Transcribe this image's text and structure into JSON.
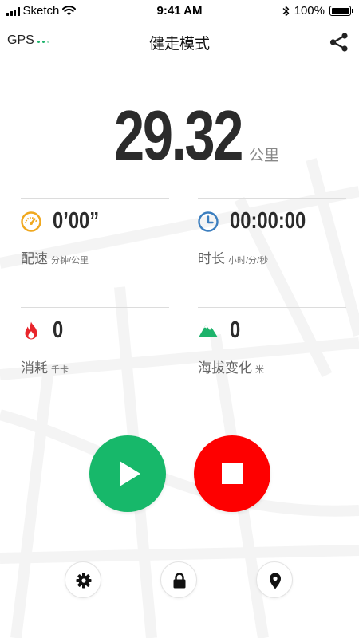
{
  "status_bar": {
    "carrier": "Sketch",
    "time": "9:41 AM",
    "battery": "100%",
    "icons": [
      "signal-icon",
      "wifi-icon",
      "bluetooth-icon",
      "battery-icon"
    ]
  },
  "nav": {
    "gps_label": "GPS",
    "title": "健走模式",
    "share_icon": "share-icon"
  },
  "distance": {
    "value": "29.32",
    "unit": "公里"
  },
  "stats": {
    "pace": {
      "value": "0’00”",
      "label": "配速",
      "unit": "分钟/公里",
      "icon": "speedometer-icon"
    },
    "duration": {
      "value": "00:00:00",
      "label": "时长",
      "unit": "小时/分/秒",
      "icon": "clock-icon"
    },
    "calories": {
      "value": "0",
      "label": "消耗",
      "unit": "千卡",
      "icon": "flame-icon"
    },
    "elevation": {
      "value": "0",
      "label": "海拔变化",
      "unit": "米",
      "icon": "mountain-icon"
    }
  },
  "controls": {
    "play_icon": "play-icon",
    "stop_icon": "stop-icon",
    "settings_icon": "gear-icon",
    "lock_icon": "lock-icon",
    "location_icon": "location-pin-icon"
  },
  "colors": {
    "green": "#17b86a",
    "red": "#fe0000",
    "orange": "#f0a81e",
    "blue": "#3d7fbf",
    "flame_red": "#e8252b",
    "mountain_green": "#1db36b",
    "text_dark": "#2b2b2b",
    "text_gray": "#666666"
  }
}
